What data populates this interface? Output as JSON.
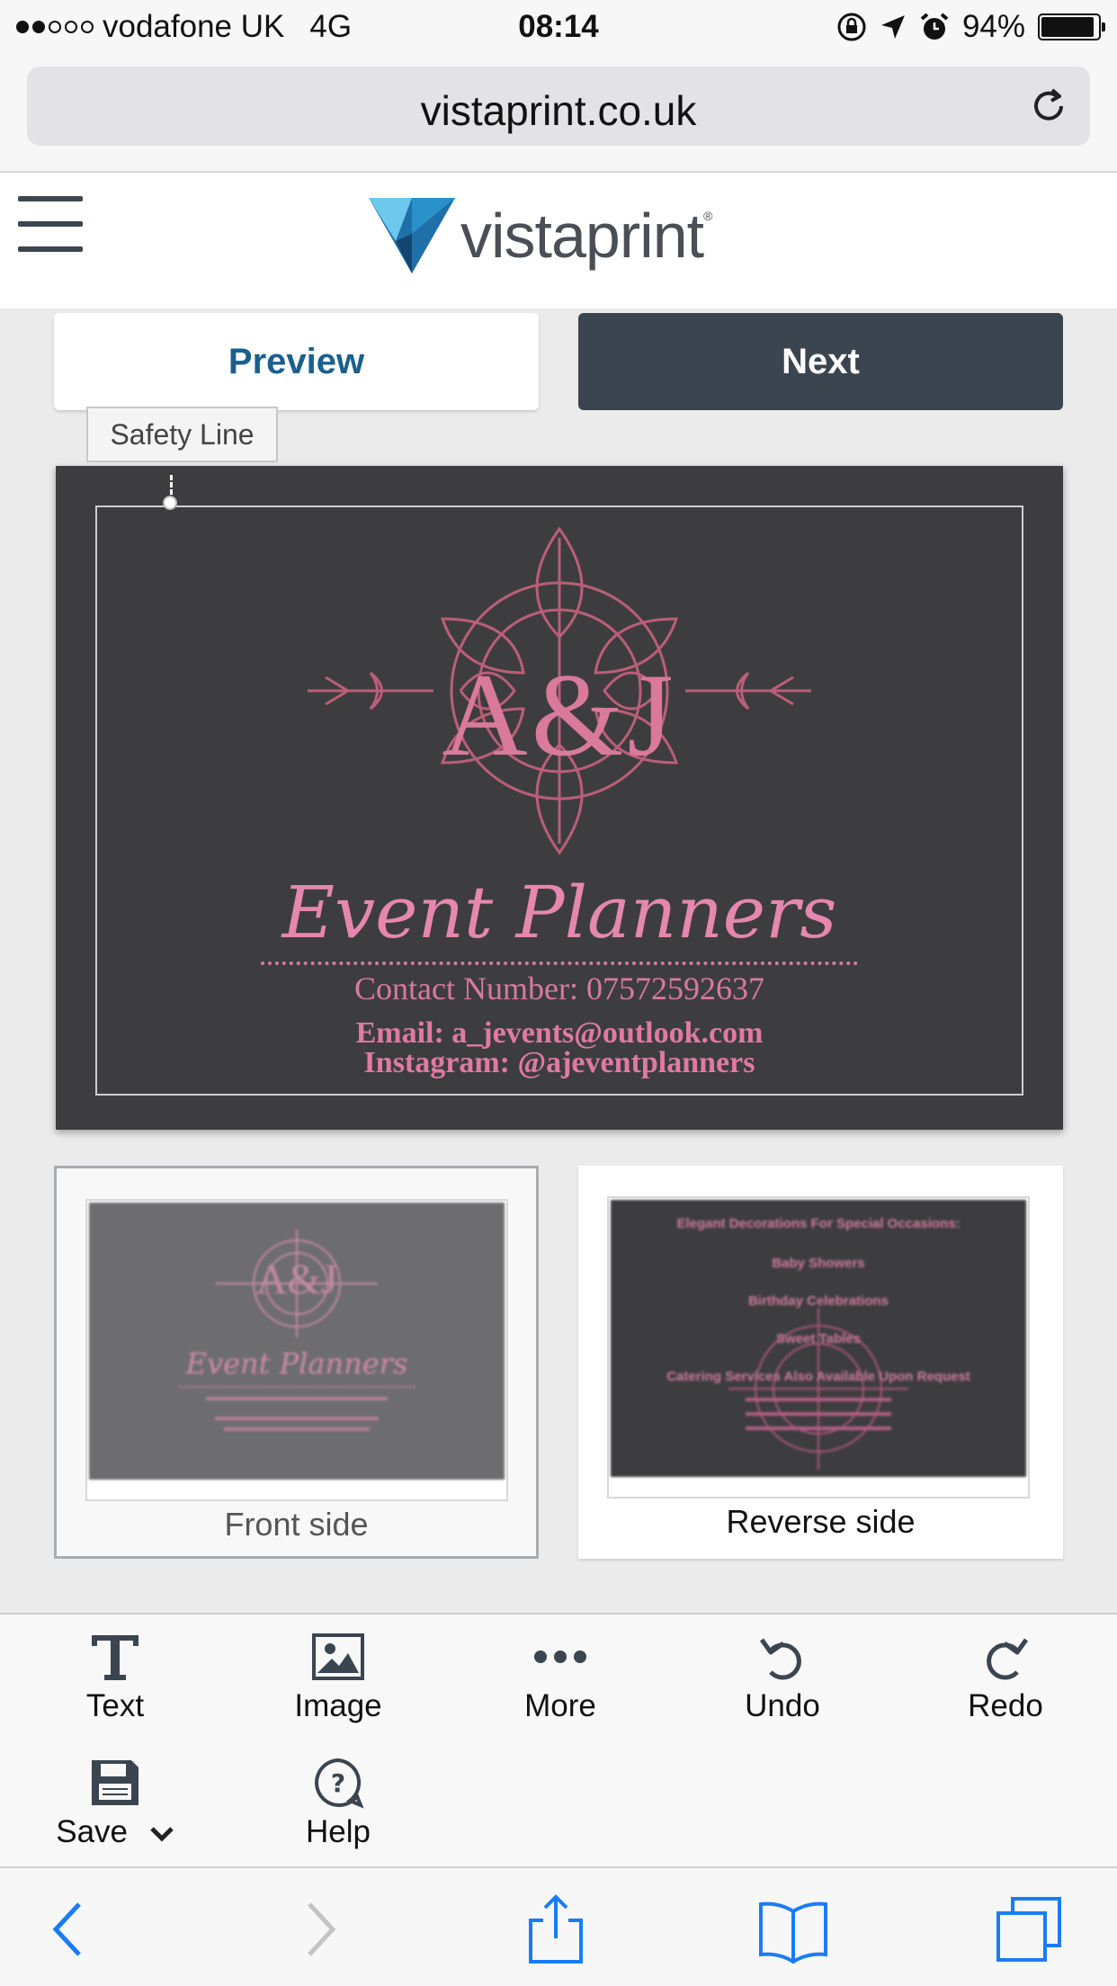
{
  "status_bar": {
    "carrier": "vodafone UK",
    "network": "4G",
    "time": "08:14",
    "battery": "94%",
    "battery_level": 0.94,
    "signal_bars": 2
  },
  "browser": {
    "url": "vistaprint.co.uk"
  },
  "header": {
    "brand": "vistaprint",
    "brand_mark": "®"
  },
  "actions": {
    "preview": "Preview",
    "next": "Next"
  },
  "design": {
    "safety_label": "Safety Line",
    "monogram": "A&J",
    "title": "Event Planners",
    "contact": "Contact Number: 07572592637",
    "email": "Email: a_jevents@outlook.com",
    "instagram": "Instagram: @ajeventplanners"
  },
  "sides": {
    "front": {
      "label": "Front side",
      "thumb_monogram": "A&J",
      "thumb_title": "Event Planners"
    },
    "reverse": {
      "label": "Reverse side",
      "thumb_lines": [
        "Elegant Decorations For Special Occasions:",
        "Baby Showers",
        "Birthday Celebrations",
        "Sweet Tables",
        "Catering Services Also Available Upon Request"
      ]
    }
  },
  "toolbar": {
    "text": "Text",
    "image": "Image",
    "more": "More",
    "undo": "Undo",
    "redo": "Redo",
    "save": "Save",
    "help": "Help"
  },
  "colors": {
    "accent_blue": "#1a5f8e",
    "next_button": "#3a4550",
    "card_bg": "#3d3d3f",
    "pink": "#e687ad",
    "safari_blue": "#1a7cf5"
  }
}
